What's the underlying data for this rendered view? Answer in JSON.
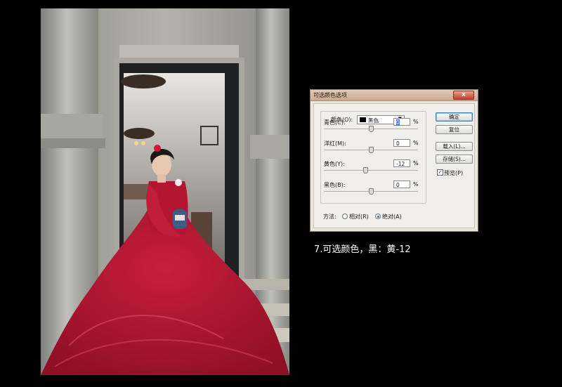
{
  "dialog": {
    "title": "可选颜色选项",
    "close_symbol": "x",
    "color_label": "颜色(O):",
    "color_value": "黑色",
    "sliders": [
      {
        "label": "青色(C):",
        "value": "0",
        "unit": "%",
        "level": 0.5
      },
      {
        "label": "洋红(M):",
        "value": "0",
        "unit": "%",
        "level": 0.5
      },
      {
        "label": "黄色(Y):",
        "value": "-12",
        "unit": "%",
        "level": 0.44
      },
      {
        "label": "黑色(B):",
        "value": "0",
        "unit": "%",
        "level": 0.5
      }
    ],
    "buttons": {
      "ok": "确定",
      "reset": "复位",
      "load": "载入(L)...",
      "save": "存储(S)..."
    },
    "preview": {
      "label": "预览(P)",
      "checked": true
    },
    "method": {
      "label": "方法:",
      "relative": "相对(R)",
      "absolute": "绝对(A)",
      "selected": "absolute"
    }
  },
  "caption": "7.可选颜色，黑：黄-12",
  "icons": {
    "dropdown": "chevron-down-icon",
    "close": "close-icon",
    "check": "check-icon"
  }
}
